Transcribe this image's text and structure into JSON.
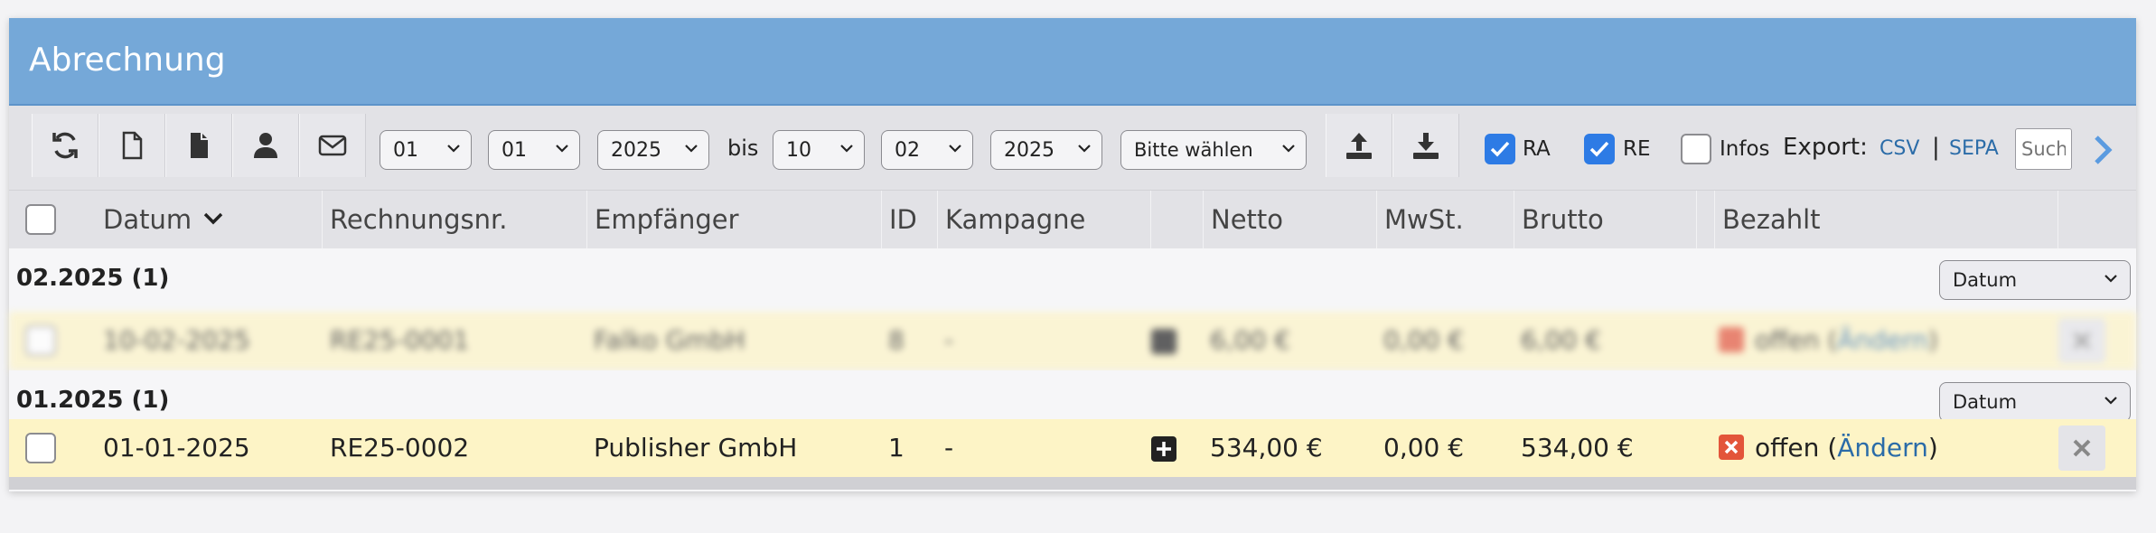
{
  "window": {
    "title": "Abrechnung"
  },
  "toolbar": {
    "buttons": [
      "refresh-icon",
      "new-document-icon",
      "document-icon",
      "user-icon",
      "mail-icon",
      "upload-icon",
      "download-icon"
    ],
    "from_day": "01",
    "from_month": "01",
    "from_year": "2025",
    "range_separator": "bis",
    "to_day": "10",
    "to_month": "02",
    "to_year": "2025",
    "choose_placeholder": "Bitte wählen",
    "ra_label": "RA",
    "re_label": "RE",
    "infos_label": "Infos",
    "export_label": "Export:",
    "export_csv": "CSV",
    "export_sep": "|",
    "export_sepa": "SEPA",
    "search_placeholder": "Suche"
  },
  "table": {
    "columns": [
      "Datum",
      "Rechnungsnr.",
      "Empfänger",
      "ID",
      "Kampagne",
      "Netto",
      "MwSt.",
      "Brutto",
      "Bezahlt"
    ],
    "groups": [
      {
        "label": "02.2025 (1)",
        "sort_value": "Datum",
        "rows": [
          {
            "datum": "10-02-2025",
            "rechnungsnr": "RE25-0001",
            "empfaenger": "Falko GmbH",
            "id": "8",
            "kampagne": "-",
            "netto": "6,00 €",
            "mwst": "0,00 €",
            "brutto": "6,00 €",
            "bezahlt": "offen",
            "aendern_open": "(",
            "aendern": "Ändern",
            "aendern_close": ")"
          }
        ]
      },
      {
        "label": "01.2025 (1)",
        "sort_value": "Datum",
        "rows": [
          {
            "datum": "01-01-2025",
            "rechnungsnr": "RE25-0002",
            "empfaenger": "Publisher GmbH",
            "id": "1",
            "kampagne": "-",
            "netto": "534,00 €",
            "mwst": "0,00 €",
            "brutto": "534,00 €",
            "bezahlt": "offen",
            "aendern_open": "(",
            "aendern": "Ändern",
            "aendern_close": ")"
          }
        ]
      }
    ]
  },
  "colors": {
    "title_bar": "#75a8d8",
    "row_highlight": "#fdf4c6",
    "link": "#2b6ca8",
    "checkbox_on": "#2d7be5",
    "status_red": "#e3553a"
  }
}
